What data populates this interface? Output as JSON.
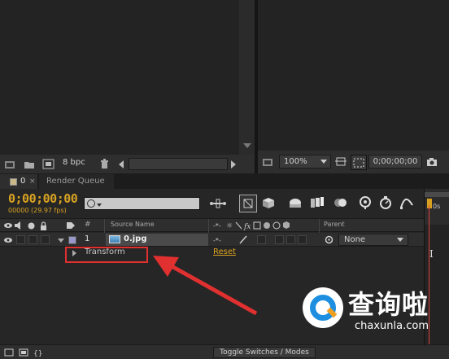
{
  "project_panel": {
    "bpc_label": "8 bpc"
  },
  "composition_viewer": {
    "zoom_value": "100%",
    "timecode": "0;00;00;00"
  },
  "tabs": [
    {
      "label": "0",
      "active": true
    },
    {
      "label": "Render Queue",
      "active": false
    }
  ],
  "timeline": {
    "current_time": "0;00;00;00",
    "frame_info": "00000 (29.97 fps)",
    "search_placeholder": "",
    "ruler_start_label": "0s",
    "columns": {
      "number": "#",
      "source_name": "Source Name",
      "parent": "Parent"
    },
    "layers": [
      {
        "number": "1",
        "name": "0.jpg",
        "parent": "None",
        "label_color": "#9a98c8"
      }
    ],
    "property_group": {
      "name": "Transform",
      "reset_label": "Reset"
    },
    "footer": {
      "toggle_label": "Toggle Switches / Modes"
    }
  },
  "watermark": {
    "chinese_text": "查询啦",
    "site_text": "chaxunla.com"
  },
  "colors": {
    "timecode": "#d9a322",
    "reset_link": "#d9a322",
    "annotation": "#e03030",
    "playhead": "#d8a020",
    "layer_bar": "#6e6a9c"
  }
}
